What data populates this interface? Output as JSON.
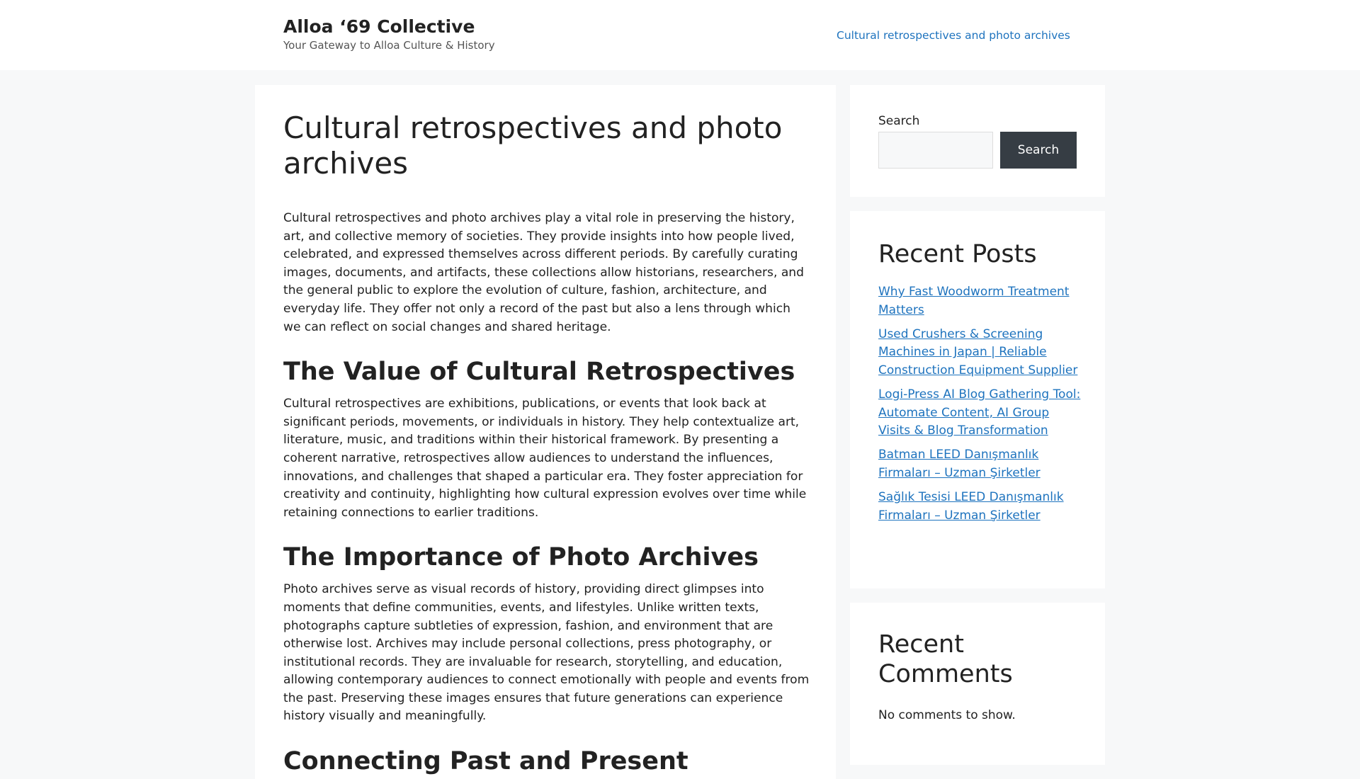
{
  "header": {
    "site_title": "Alloa ‘69 Collective",
    "tagline": "Your Gateway to Alloa Culture & History",
    "nav_link": "Cultural retrospectives and photo archives"
  },
  "article": {
    "title": "Cultural retrospectives and photo archives",
    "intro": "Cultural retrospectives and photo archives play a vital role in preserving the history, art, and collective memory of societies. They provide insights into how people lived, celebrated, and expressed themselves across different periods. By carefully curating images, documents, and artifacts, these collections allow historians, researchers, and the general public to explore the evolution of culture, fashion, architecture, and everyday life. They offer not only a record of the past but also a lens through which we can reflect on social changes and shared heritage.",
    "section1_heading": "The Value of Cultural Retrospectives",
    "section1_text": "Cultural retrospectives are exhibitions, publications, or events that look back at significant periods, movements, or individuals in history. They help contextualize art, literature, music, and traditions within their historical framework. By presenting a coherent narrative, retrospectives allow audiences to understand the influences, innovations, and challenges that shaped a particular era. They foster appreciation for creativity and continuity, highlighting how cultural expression evolves over time while retaining connections to earlier traditions.",
    "section2_heading": "The Importance of Photo Archives",
    "section2_text": "Photo archives serve as visual records of history, providing direct glimpses into moments that define communities, events, and lifestyles. Unlike written texts, photographs capture subtleties of expression, fashion, and environment that are otherwise lost. Archives may include personal collections, press photography, or institutional records. They are invaluable for research, storytelling, and education, allowing contemporary audiences to connect emotionally with people and events from the past. Preserving these images ensures that future generations can experience history visually and meaningfully.",
    "section3_heading": "Connecting Past and Present"
  },
  "sidebar": {
    "search": {
      "label": "Search",
      "button": "Search",
      "placeholder": ""
    },
    "recent_posts": {
      "heading": "Recent Posts",
      "items": [
        "Why Fast Woodworm Treatment Matters",
        "Used Crushers & Screening Machines in Japan | Reliable Construction Equipment Supplier",
        "Logi-Press AI Blog Gathering Tool: Automate Content, AI Group Visits & Blog Transformation",
        "Batman LEED Danışmanlık Firmaları – Uzman Şirketler",
        "Sağlık Tesisi LEED Danışmanlık Firmaları – Uzman Şirketler"
      ]
    },
    "recent_comments": {
      "heading": "Recent Comments",
      "empty_text": "No comments to show."
    }
  },
  "colors": {
    "background": "#f7f8f9",
    "card": "#ffffff",
    "link": "#1e73be",
    "button": "#363d44",
    "text": "#222222"
  }
}
